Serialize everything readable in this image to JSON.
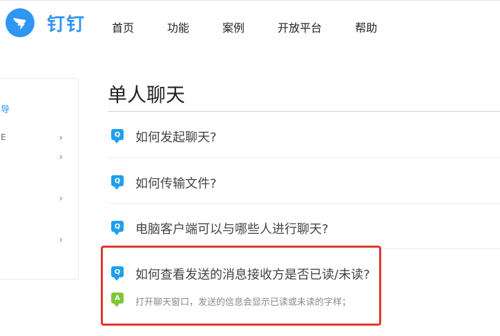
{
  "brand": {
    "name": "钉钉",
    "color": "#2f96f3",
    "logo_icon": "dingtalk-wing-icon"
  },
  "nav": {
    "items": [
      {
        "label": "首页"
      },
      {
        "label": "功能"
      },
      {
        "label": "案例"
      },
      {
        "label": "开放平台"
      },
      {
        "label": "帮助"
      }
    ]
  },
  "sidebar": {
    "heading": "导",
    "items": [
      {
        "label": "E",
        "chevron": "›"
      },
      {
        "label": "",
        "chevron": "›"
      },
      {
        "label": "",
        "chevron": "›"
      },
      {
        "label": "",
        "chevron": "›"
      }
    ]
  },
  "main": {
    "title": "单人聊天",
    "faqs": [
      {
        "badge": "Q",
        "question": "如何发起聊天?"
      },
      {
        "badge": "Q",
        "question": "如何传输文件?"
      },
      {
        "badge": "Q",
        "question": "电脑客户端可以与哪些人进行聊天?"
      },
      {
        "badge": "Q",
        "question": "如何查看发送的消息接收方是否已读/未读?",
        "answer_badge": "A",
        "answer": "打开聊天窗口，发送的信息会显示已读或未读的字样；"
      }
    ]
  },
  "colors": {
    "accent": "#2f96f3",
    "q_badge": "#1ea0ee",
    "a_badge": "#7dc934",
    "highlight": "#e0362c"
  }
}
